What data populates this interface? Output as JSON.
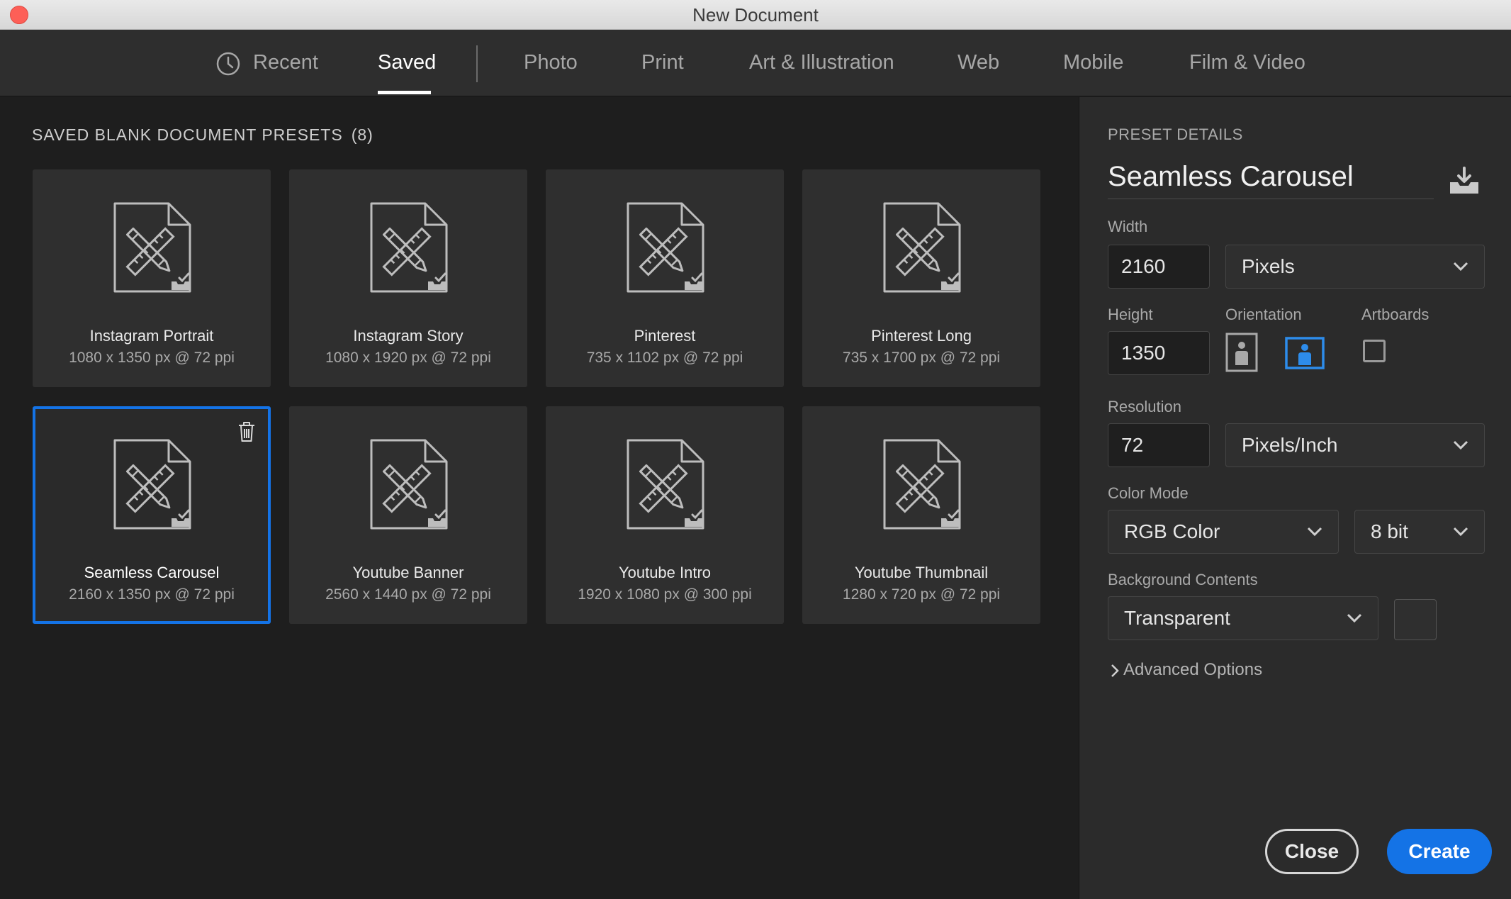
{
  "window": {
    "title": "New Document"
  },
  "tabs": [
    {
      "label": "Recent",
      "icon": "clock-icon"
    },
    {
      "label": "Saved",
      "active": true
    },
    {
      "label": "Photo"
    },
    {
      "label": "Print"
    },
    {
      "label": "Art & Illustration"
    },
    {
      "label": "Web"
    },
    {
      "label": "Mobile"
    },
    {
      "label": "Film & Video"
    }
  ],
  "gallery": {
    "title": "SAVED BLANK DOCUMENT PRESETS",
    "count": "(8)",
    "presets": [
      {
        "name": "Instagram Portrait",
        "dims": "1080 x 1350 px @ 72 ppi"
      },
      {
        "name": "Instagram Story",
        "dims": "1080 x 1920 px @ 72 ppi"
      },
      {
        "name": "Pinterest",
        "dims": "735 x 1102 px @ 72 ppi"
      },
      {
        "name": "Pinterest Long",
        "dims": "735 x 1700 px @ 72 ppi"
      },
      {
        "name": "Seamless Carousel",
        "dims": "2160 x 1350 px @ 72 ppi",
        "selected": true
      },
      {
        "name": "Youtube Banner",
        "dims": "2560 x 1440 px @ 72 ppi"
      },
      {
        "name": "Youtube Intro",
        "dims": "1920 x 1080 px @ 300 ppi"
      },
      {
        "name": "Youtube Thumbnail",
        "dims": "1280 x 720 px @ 72 ppi"
      }
    ]
  },
  "details": {
    "heading": "PRESET DETAILS",
    "name": "Seamless Carousel",
    "width_label": "Width",
    "width_value": "2160",
    "width_unit": "Pixels",
    "height_label": "Height",
    "height_value": "1350",
    "orientation_label": "Orientation",
    "orientation_selected": "landscape",
    "artboards_label": "Artboards",
    "artboards_checked": false,
    "resolution_label": "Resolution",
    "resolution_value": "72",
    "resolution_unit": "Pixels/Inch",
    "color_mode_label": "Color Mode",
    "color_mode": "RGB Color",
    "bit_depth": "8 bit",
    "background_label": "Background Contents",
    "background": "Transparent",
    "advanced_label": "Advanced Options"
  },
  "buttons": {
    "close": "Close",
    "create": "Create"
  },
  "colors": {
    "accent": "#1473e6",
    "panel": "#2b2b2b",
    "gallery": "#1e1e1e",
    "card": "#2f2f2f"
  }
}
